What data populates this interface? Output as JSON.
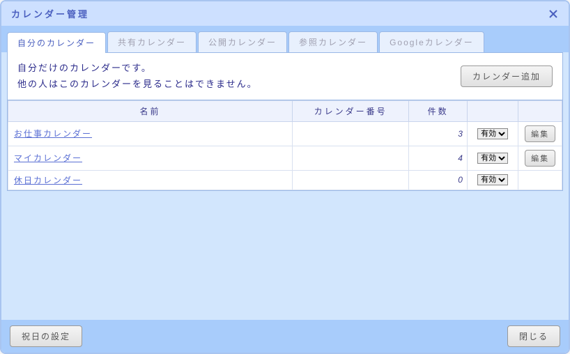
{
  "title": "カレンダー管理",
  "tabs": [
    {
      "label": "自分のカレンダー",
      "active": true
    },
    {
      "label": "共有カレンダー",
      "active": false
    },
    {
      "label": "公開カレンダー",
      "active": false
    },
    {
      "label": "参照カレンダー",
      "active": false
    },
    {
      "label": "Googleカレンダー",
      "active": false
    }
  ],
  "description": {
    "line1": "自分だけのカレンダーです。",
    "line2": "他の人はこのカレンダーを見ることはできません。"
  },
  "buttons": {
    "add_calendar": "カレンダー追加",
    "edit": "編集",
    "holiday_settings": "祝日の設定",
    "close": "閉じる"
  },
  "table": {
    "headers": {
      "name": "名前",
      "number": "カレンダー番号",
      "count": "件数",
      "status": "",
      "action": ""
    },
    "status_options": {
      "active": "有効"
    },
    "rows": [
      {
        "name": "お仕事カレンダー",
        "number": "",
        "count": "3",
        "status": "有効",
        "editable": true
      },
      {
        "name": "マイカレンダー",
        "number": "",
        "count": "4",
        "status": "有効",
        "editable": true
      },
      {
        "name": "休日カレンダー",
        "number": "",
        "count": "0",
        "status": "有効",
        "editable": false
      }
    ]
  }
}
